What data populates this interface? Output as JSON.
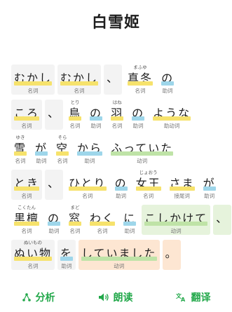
{
  "title": "白雪姬",
  "rows": [
    [
      {
        "furi": "",
        "word": "むかし",
        "pos": "名词",
        "type": "noun",
        "box": "light"
      },
      {
        "furi": "",
        "word": "むかし",
        "pos": "名词",
        "type": "noun",
        "box": "light"
      },
      {
        "furi": "",
        "word": "、",
        "pos": "",
        "type": "punct",
        "box": "light"
      },
      {
        "furi": "まふゆ",
        "word": "真冬",
        "pos": "名词",
        "type": "noun",
        "box": "none"
      },
      {
        "furi": "",
        "word": "の",
        "pos": "助词",
        "type": "part",
        "box": "none"
      }
    ],
    [
      {
        "furi": "",
        "word": "ころ",
        "pos": "名词",
        "type": "noun",
        "box": "light"
      },
      {
        "furi": "",
        "word": "、",
        "pos": "",
        "type": "punct",
        "box": "light"
      },
      {
        "furi": "とり",
        "word": "鳥",
        "pos": "名词",
        "type": "noun",
        "box": "none"
      },
      {
        "furi": "",
        "word": "の",
        "pos": "助词",
        "type": "part",
        "box": "none"
      },
      {
        "furi": "はね",
        "word": "羽",
        "pos": "名词",
        "type": "noun",
        "box": "none"
      },
      {
        "furi": "",
        "word": "の",
        "pos": "助词",
        "type": "part",
        "box": "none"
      },
      {
        "furi": "",
        "word": "ような",
        "pos": "助动词",
        "type": "noun",
        "box": "none"
      }
    ],
    [
      {
        "furi": "ゆき",
        "word": "雪",
        "pos": "名词",
        "type": "noun",
        "box": "none"
      },
      {
        "furi": "",
        "word": "が",
        "pos": "助词",
        "type": "part",
        "box": "none"
      },
      {
        "furi": "そら",
        "word": "空",
        "pos": "名词",
        "type": "noun",
        "box": "none"
      },
      {
        "furi": "",
        "word": "から",
        "pos": "助词",
        "type": "part",
        "box": "none"
      },
      {
        "furi": "",
        "word": "ふっていた",
        "pos": "动词",
        "type": "verb",
        "box": "none"
      }
    ],
    [
      {
        "furi": "",
        "word": "とき",
        "pos": "名词",
        "type": "noun",
        "box": "light"
      },
      {
        "furi": "",
        "word": "、",
        "pos": "",
        "type": "punct",
        "box": "light"
      },
      {
        "furi": "",
        "word": "ひとり",
        "pos": "名词",
        "type": "noun",
        "box": "none"
      },
      {
        "furi": "",
        "word": "の",
        "pos": "助词",
        "type": "part",
        "box": "none"
      },
      {
        "furi": "じょおう",
        "word": "女王",
        "pos": "名词",
        "type": "noun",
        "box": "none"
      },
      {
        "furi": "",
        "word": "さま",
        "pos": "接尾词",
        "type": "noun",
        "box": "none"
      },
      {
        "furi": "",
        "word": "が",
        "pos": "助词",
        "type": "part",
        "box": "none"
      }
    ],
    [
      {
        "furi": "こくたん",
        "word": "黒檀",
        "pos": "名词",
        "type": "noun",
        "box": "none"
      },
      {
        "furi": "",
        "word": "の",
        "pos": "助词",
        "type": "part",
        "box": "none"
      },
      {
        "furi": "まど",
        "word": "窓",
        "pos": "名词",
        "type": "noun",
        "box": "none"
      },
      {
        "furi": "",
        "word": "わく",
        "pos": "名词",
        "type": "noun",
        "box": "none"
      },
      {
        "furi": "",
        "word": "に",
        "pos": "助词",
        "type": "part",
        "box": "none"
      },
      {
        "furi": "",
        "word": "こしかけて",
        "pos": "动词",
        "type": "verb",
        "box": "green"
      },
      {
        "furi": "",
        "word": "、",
        "pos": "",
        "type": "punct",
        "box": "green"
      }
    ],
    [
      {
        "furi": "ぬいもの",
        "word": "ぬい物",
        "pos": "名词",
        "type": "noun",
        "box": "light"
      },
      {
        "furi": "",
        "word": "を",
        "pos": "助词",
        "type": "part",
        "box": "light"
      },
      {
        "furi": "",
        "word": "していました",
        "pos": "动词",
        "type": "verb",
        "box": "orange"
      },
      {
        "furi": "",
        "word": "。",
        "pos": "",
        "type": "punct",
        "box": "orange"
      }
    ]
  ],
  "toolbar": {
    "analyze": "分析",
    "read": "朗读",
    "translate": "翻译",
    "accent": "#22a84a"
  }
}
